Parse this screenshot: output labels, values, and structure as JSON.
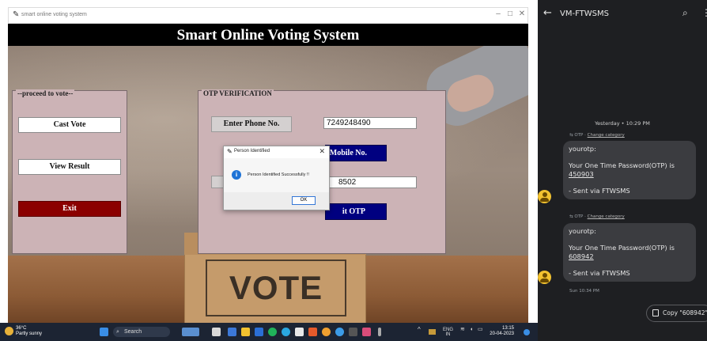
{
  "window": {
    "title": "smart online voting system",
    "controls": {
      "minimize": "–",
      "maximize": "□",
      "close": "✕"
    }
  },
  "app": {
    "header": "Smart Online Voting System",
    "proceed_panel": {
      "legend": "proceed to vote",
      "cast_vote": "Cast Vote",
      "view_result": "View Result",
      "exit": "Exit"
    },
    "otp_panel": {
      "legend": "OTP VERIFICATION",
      "phone_label": "Enter Phone No.",
      "phone_value": "7249248490",
      "mobile_button_visible": "Mobile No.",
      "otp_value_visible": "8502",
      "submit_visible": "it OTP"
    },
    "background_sign": "VOTE"
  },
  "dialog": {
    "title": "Person Identified",
    "message": "Person Identified Successfully !!",
    "ok": "OK",
    "close": "✕"
  },
  "taskbar": {
    "weather_temp": "36°C",
    "weather_desc": "Partly sunny",
    "search": "Search",
    "lang_top": "ENG",
    "lang_bottom": "IN",
    "time": "13:15",
    "date": "20-04-2023"
  },
  "phone": {
    "title": "VM-FTWSMS",
    "day_stamp": "Yesterday • 10:29 PM",
    "category_label": "OTP",
    "category_change": "Change category",
    "messages": [
      {
        "sender": "yourotp:",
        "body": "Your One Time Password(OTP) is",
        "otp": "450903",
        "footer": "- Sent via FTWSMS"
      },
      {
        "sender": "yourotp:",
        "body": "Your One Time Password(OTP) is",
        "otp": "608942",
        "footer": "- Sent via FTWSMS"
      }
    ],
    "last_time": "Sun 10:34 PM",
    "copy_chip": "Copy \"608942\""
  },
  "colors": {
    "exit_button": "#8b0000",
    "navy_button": "#000080",
    "panel_bg": "#ccb3b6",
    "phone_bg": "#1e1f22",
    "bubble_bg": "#3b3c40"
  }
}
